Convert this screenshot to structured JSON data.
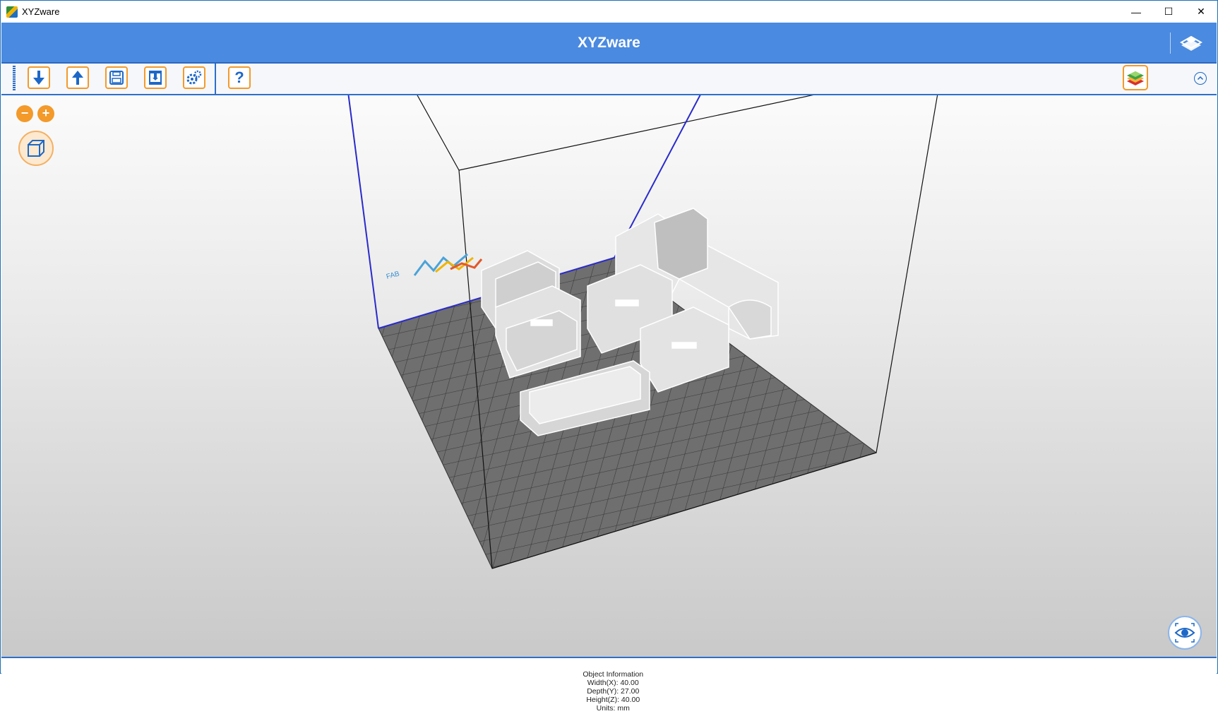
{
  "window": {
    "title": "XYZware",
    "controls": {
      "minimize": "—",
      "maximize": "☐",
      "close": "✕"
    }
  },
  "header": {
    "title": "XYZware",
    "right_icon": "stacked-layers-logo-icon"
  },
  "toolbar": {
    "buttons": [
      {
        "name": "import-button",
        "icon": "arrow-down-icon"
      },
      {
        "name": "export-button",
        "icon": "arrow-up-icon"
      },
      {
        "name": "save-button",
        "icon": "floppy-disk-icon"
      },
      {
        "name": "print-button",
        "icon": "printer-icon"
      },
      {
        "name": "settings-button",
        "icon": "gears-icon"
      },
      {
        "name": "help-button",
        "icon": "question-mark-icon",
        "glyph": "?"
      }
    ],
    "right_buttons": [
      {
        "name": "layers-button",
        "icon": "layers-icon"
      },
      {
        "name": "collapse-button",
        "icon": "chevron-up-icon"
      }
    ]
  },
  "viewport": {
    "zoom_out": "−",
    "zoom_in": "+",
    "view_cube": "cube-icon",
    "preview": "eye-icon",
    "bed_logo": "XYZ printing logo"
  },
  "status": {
    "object_info_label": "Object Information",
    "width": "Width(X): 40.00",
    "depth": "Depth(Y): 27.00",
    "height": "Height(Z): 40.00",
    "units": "Units: mm"
  },
  "colors": {
    "header_blue": "#4a8ae0",
    "accent_orange": "#f39a2a",
    "divider_blue": "#2f6fc8",
    "bed_grey": "#6b6b6b",
    "model_white": "#f2f2f2"
  }
}
